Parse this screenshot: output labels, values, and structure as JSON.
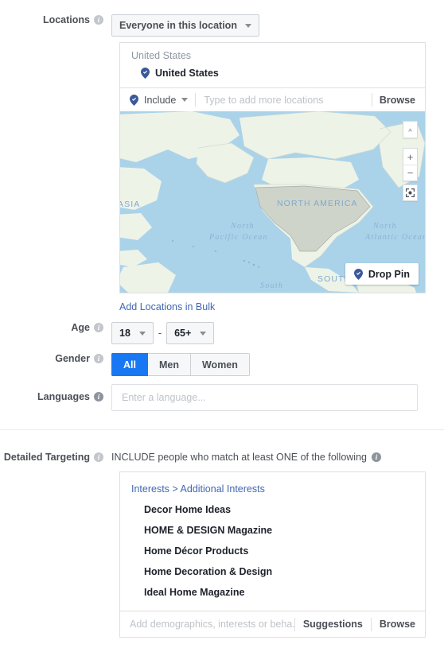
{
  "locations": {
    "label": "Locations",
    "scope_select": {
      "value": "Everyone in this location"
    },
    "panel": {
      "group_header": "United States",
      "selected_location": "United States",
      "mode_select": {
        "value": "Include"
      },
      "typeahead_placeholder": "Type to add more locations",
      "typeahead_value": "",
      "browse_label": "Browse"
    },
    "bulk_link": "Add Locations in Bulk"
  },
  "map": {
    "drop_pin_label": "Drop Pin",
    "labels": {
      "asia": "ASIA",
      "north_america": "NORTH AMERICA",
      "north_pacific_ocean": "North\nPacific Ocean",
      "north_pacific_line1": "North",
      "north_pacific_line2": "Pacific Ocean",
      "north_atlantic_line1": "North",
      "north_atlantic_line2": "Atlantic Ocean",
      "south_america": "SOUTH AMERICA",
      "south": "South"
    },
    "controls": {
      "compass": "compass-north",
      "zoom_in": "+",
      "zoom_out": "−",
      "locate": "fit-to-bounds"
    },
    "colors": {
      "ocean": "#aad3ea",
      "land": "#eef3e7",
      "highlight": "#c8ccc4",
      "pin": "#1e3e7b"
    }
  },
  "age": {
    "label": "Age",
    "min": {
      "value": "18"
    },
    "separator": "-",
    "max": {
      "value": "65+"
    }
  },
  "gender": {
    "label": "Gender",
    "options": [
      {
        "label": "All",
        "selected": true
      },
      {
        "label": "Men",
        "selected": false
      },
      {
        "label": "Women",
        "selected": false
      }
    ],
    "accent_color": "#1877f2"
  },
  "languages": {
    "label": "Languages",
    "placeholder": "Enter a language...",
    "value": ""
  },
  "detailed_targeting": {
    "label": "Detailed Targeting",
    "caption": "INCLUDE people who match at least ONE of the following",
    "breadcrumb": {
      "root": "Interests",
      "separator": ">",
      "child": "Additional Interests"
    },
    "interests": [
      "Decor Home Ideas",
      "HOME & DESIGN Magazine",
      "Home Décor Products",
      "Home Decoration & Design",
      "Ideal Home Magazine"
    ],
    "typeahead_placeholder": "Add demographics, interests or beha...",
    "typeahead_value": "",
    "suggestions_label": "Suggestions",
    "browse_label": "Browse"
  },
  "colors": {
    "link": "#4267b2",
    "label_text": "#4b4f56",
    "body_text": "#1d2129",
    "border": "#dddfe2",
    "control_bg": "#f6f7f9"
  }
}
